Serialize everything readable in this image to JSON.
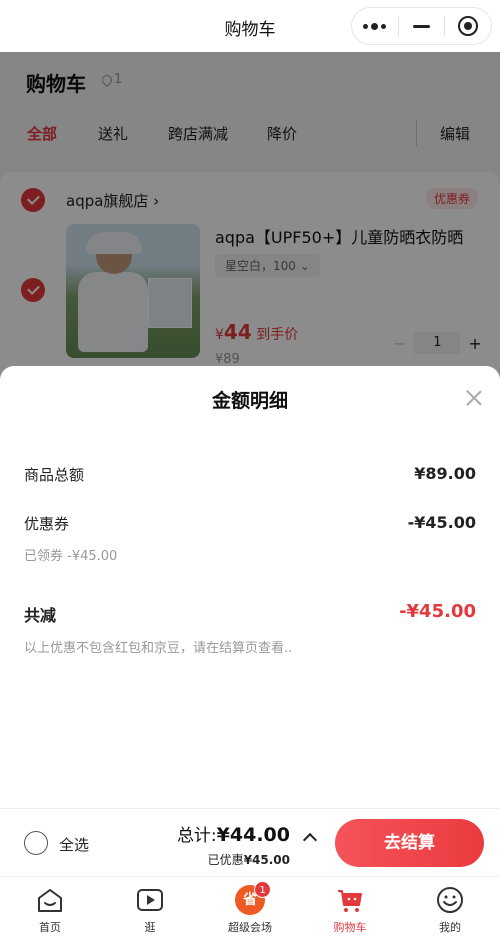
{
  "titlebar": {
    "title": "购物车"
  },
  "cart": {
    "title": "购物车",
    "location_count": "1",
    "tabs": [
      {
        "label": "全部",
        "active": true
      },
      {
        "label": "送礼"
      },
      {
        "label": "跨店满减"
      },
      {
        "label": "降价"
      }
    ],
    "edit_label": "编辑"
  },
  "store": {
    "name": "aqpa旗舰店",
    "coupon_tag": "优惠券",
    "product": {
      "title": "aqpa【UPF50+】儿童防晒衣防晒",
      "sku": "星空白，100",
      "price_symbol": "¥",
      "price": "44",
      "price_suffix": "到手价",
      "original_price": "¥89",
      "quantity": "1"
    }
  },
  "sheet": {
    "title": "金额明细",
    "rows": {
      "goods_total_label": "商品总额",
      "goods_total_value": "¥89.00",
      "coupon_label": "优惠券",
      "coupon_value": "-¥45.00",
      "coupon_sub": "已领券 -¥45.00",
      "total_reduce_label": "共减",
      "total_reduce_value": "-¥45.00",
      "note": "以上优惠不包含红包和京豆，请在结算页查看.."
    }
  },
  "checkout": {
    "select_all_label": "全选",
    "total_prefix": "总计:",
    "total_value": "¥44.00",
    "saved_prefix": "已优惠",
    "saved_value": "¥45.00",
    "button_label": "去结算"
  },
  "tabbar": {
    "items": [
      {
        "label": "首页",
        "icon": "home-icon"
      },
      {
        "label": "逛",
        "icon": "video-icon"
      },
      {
        "label": "超级会场",
        "icon": "save-icon",
        "glyph": "省",
        "badge": "1"
      },
      {
        "label": "购物车",
        "icon": "cart-icon",
        "active": true
      },
      {
        "label": "我的",
        "icon": "smile-icon"
      }
    ]
  },
  "colors": {
    "accent": "#e4393c",
    "checkout_button": "#ea3b3f"
  }
}
